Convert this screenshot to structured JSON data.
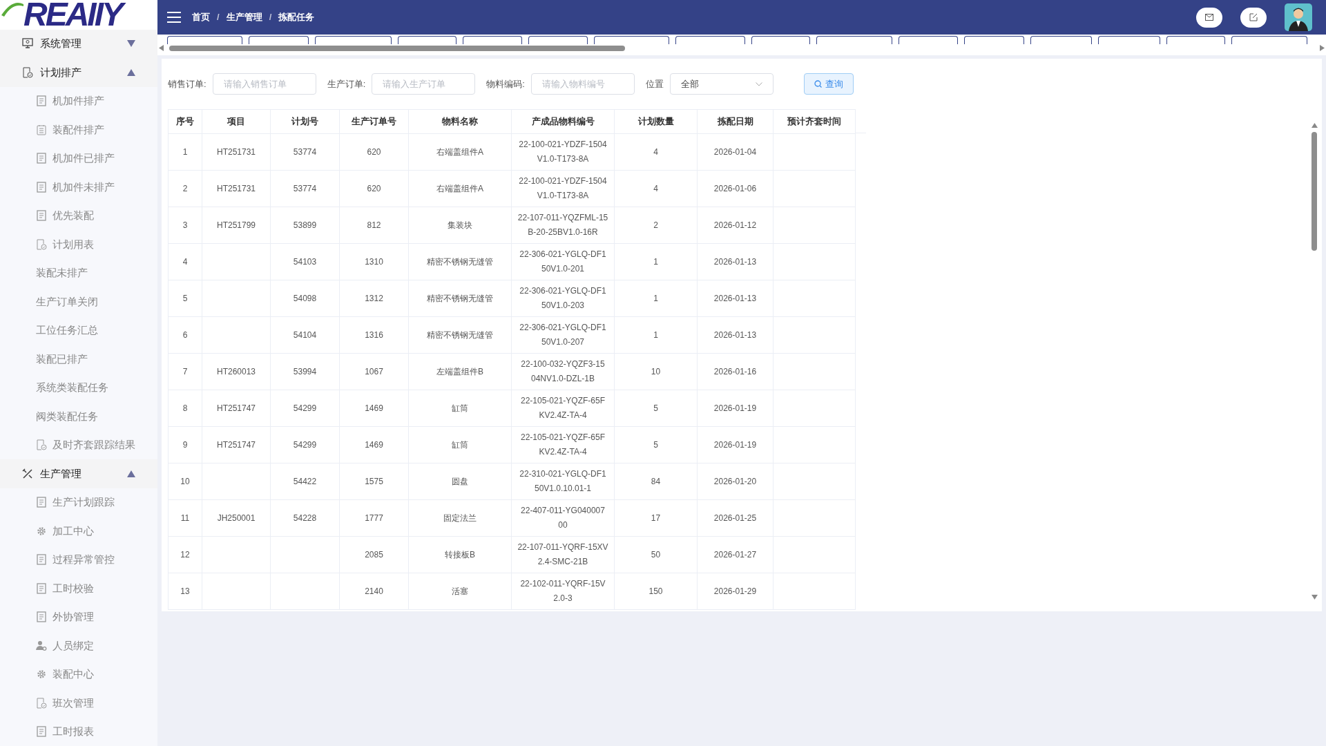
{
  "logo": {
    "text": "REAIIY"
  },
  "sidebar": {
    "groups": [
      {
        "label": "系统管理",
        "kind": "monitor",
        "expanded": false
      },
      {
        "label": "计划排产",
        "kind": "check-doc",
        "expanded": true,
        "children": [
          {
            "label": "机加件排产",
            "kind": "doc"
          },
          {
            "label": "装配件排产",
            "kind": "list"
          },
          {
            "label": "机加件已排产",
            "kind": "doc"
          },
          {
            "label": "机加件未排产",
            "kind": "doc"
          },
          {
            "label": "优先装配",
            "kind": "doc"
          },
          {
            "label": "计划用表",
            "kind": "check-doc"
          },
          {
            "label": "装配未排产",
            "kind": "plain"
          },
          {
            "label": "生产订单关闭",
            "kind": "plain"
          },
          {
            "label": "工位任务汇总",
            "kind": "plain"
          },
          {
            "label": "装配已排产",
            "kind": "plain"
          },
          {
            "label": "系统类装配任务",
            "kind": "plain"
          },
          {
            "label": "阀类装配任务",
            "kind": "plain"
          },
          {
            "label": "及时齐套跟踪结果",
            "kind": "check-doc"
          }
        ]
      },
      {
        "label": "生产管理",
        "kind": "tools",
        "expanded": true,
        "children": [
          {
            "label": "生产计划跟踪",
            "kind": "doc"
          },
          {
            "label": "加工中心",
            "kind": "gear"
          },
          {
            "label": "过程异常管控",
            "kind": "doc"
          },
          {
            "label": "工时校验",
            "kind": "doc"
          },
          {
            "label": "外协管理",
            "kind": "doc"
          },
          {
            "label": "人员绑定",
            "kind": "person"
          },
          {
            "label": "装配中心",
            "kind": "gear"
          },
          {
            "label": "班次管理",
            "kind": "check-doc"
          },
          {
            "label": "工时报表",
            "kind": "doc"
          }
        ]
      }
    ]
  },
  "breadcrumb": [
    "首页",
    "生产管理",
    "拣配任务"
  ],
  "breadcrumb_separators": [
    "/",
    "/"
  ],
  "tabs": [
    {
      "selected": false
    },
    {
      "selected": false
    },
    {
      "selected": false
    },
    {
      "selected": false
    },
    {
      "selected": false
    },
    {
      "selected": false
    },
    {
      "selected": false
    },
    {
      "selected": false
    },
    {
      "selected": false
    },
    {
      "selected": false
    },
    {
      "selected": false
    },
    {
      "selected": false
    },
    {
      "selected": false
    },
    {
      "selected": false
    },
    {
      "selected": false
    },
    {
      "selected": false
    }
  ],
  "filters": [
    {
      "kind": "input",
      "label": "销售订单:",
      "placeholder": "请输入销售订单"
    },
    {
      "kind": "input",
      "label": "生产订单:",
      "placeholder": "请输入生产订单"
    },
    {
      "kind": "input",
      "label": "物料编码:",
      "placeholder": "请输入物料编号"
    },
    {
      "kind": "select",
      "label": "位置",
      "value": "全部"
    }
  ],
  "search_button": "查询",
  "table": {
    "columns": [
      "序号",
      "项目",
      "计划号",
      "生产订单号",
      "物料名称",
      "产成品物料编号",
      "计划数量",
      "拣配日期",
      "预计齐套时间"
    ],
    "rows": [
      [
        "1",
        "HT251731",
        "53774",
        "620",
        "右端盖组件A",
        "22-100-021-YDZF-1504\nV1.0-T173-8A",
        "4",
        "2026-01-04",
        ""
      ],
      [
        "2",
        "HT251731",
        "53774",
        "620",
        "右端盖组件A",
        "22-100-021-YDZF-1504\nV1.0-T173-8A",
        "4",
        "2026-01-06",
        ""
      ],
      [
        "3",
        "HT251799",
        "53899",
        "812",
        "集装块",
        "22-107-011-YQZFML-15\nB-20-25BV1.0-16R",
        "2",
        "2026-01-12",
        ""
      ],
      [
        "4",
        "",
        "54103",
        "1310",
        "精密不锈钢无缝管",
        "22-306-021-YGLQ-DF1\n50V1.0-201",
        "1",
        "2026-01-13",
        ""
      ],
      [
        "5",
        "",
        "54098",
        "1312",
        "精密不锈钢无缝管",
        "22-306-021-YGLQ-DF1\n50V1.0-203",
        "1",
        "2026-01-13",
        ""
      ],
      [
        "6",
        "",
        "54104",
        "1316",
        "精密不锈钢无缝管",
        "22-306-021-YGLQ-DF1\n50V1.0-207",
        "1",
        "2026-01-13",
        ""
      ],
      [
        "7",
        "HT260013",
        "53994",
        "1067",
        "左端盖组件B",
        "22-100-032-YQZF3-15\n04NV1.0-DZL-1B",
        "10",
        "2026-01-16",
        ""
      ],
      [
        "8",
        "HT251747",
        "54299",
        "1469",
        "缸筒",
        "22-105-021-YQZF-65F\nKV2.4Z-TA-4",
        "5",
        "2026-01-19",
        ""
      ],
      [
        "9",
        "HT251747",
        "54299",
        "1469",
        "缸筒",
        "22-105-021-YQZF-65F\nKV2.4Z-TA-4",
        "5",
        "2026-01-19",
        ""
      ],
      [
        "10",
        "",
        "54422",
        "1575",
        "圆盘",
        "22-310-021-YGLQ-DF1\n50V1.0.10.01-1",
        "84",
        "2026-01-20",
        ""
      ],
      [
        "11",
        "JH250001",
        "54228",
        "1777",
        "固定法兰",
        "22-407-011-YG040007\n00",
        "17",
        "2026-01-25",
        ""
      ],
      [
        "12",
        "",
        "",
        "2085",
        "转接板B",
        "22-107-011-YQRF-15XV\n2.4-SMC-21B",
        "50",
        "2026-01-27",
        ""
      ],
      [
        "13",
        "",
        "",
        "2140",
        "活塞",
        "22-102-011-YQRF-15V\n2.0-3",
        "150",
        "2026-01-29",
        ""
      ]
    ]
  }
}
